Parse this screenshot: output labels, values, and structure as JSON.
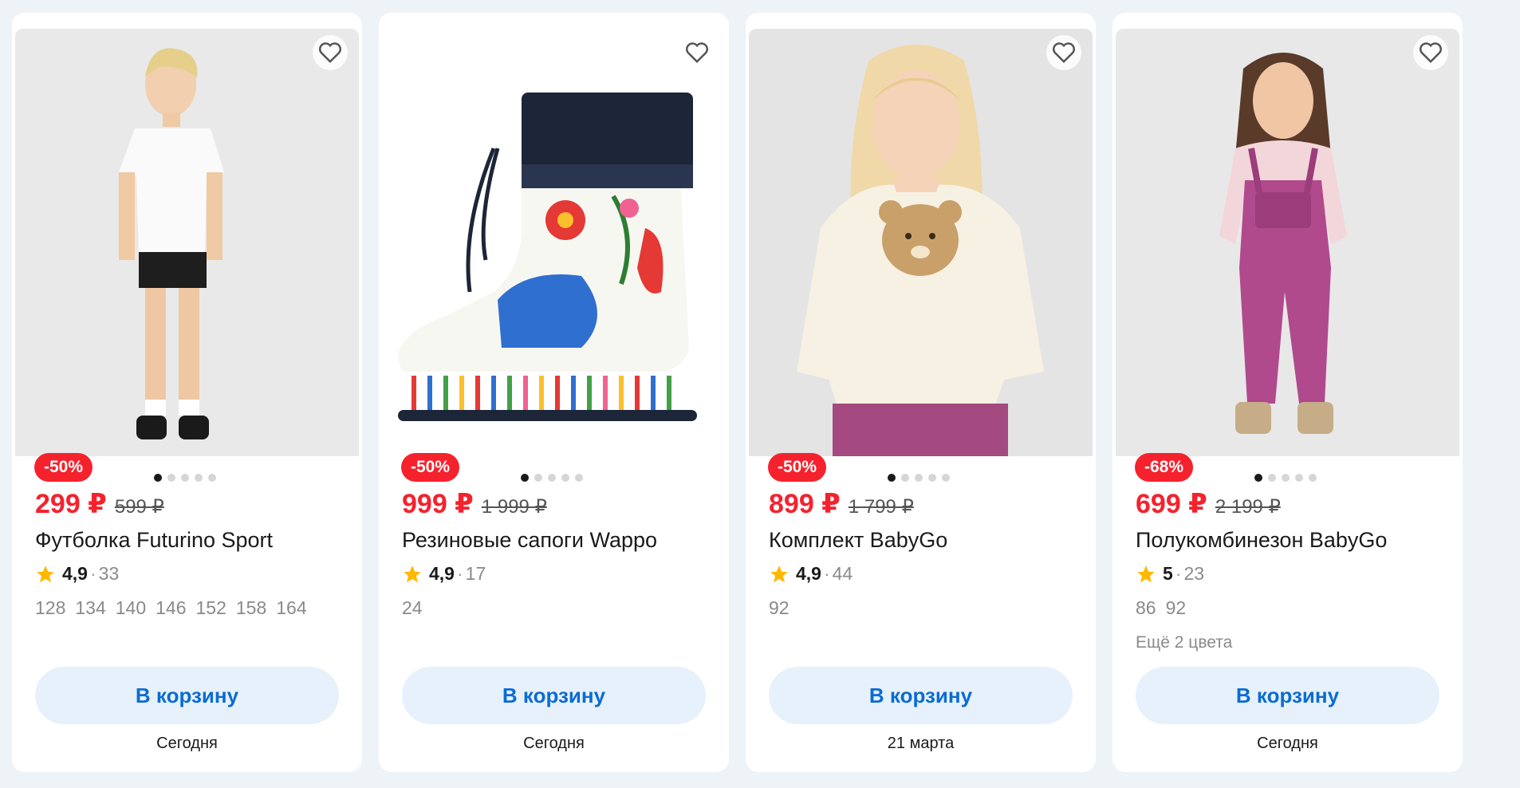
{
  "products": [
    {
      "discount": "-50%",
      "price": "299 ₽",
      "old_price": "599 ₽",
      "title": "Футболка Futurino Sport",
      "rating": "4,9",
      "reviews": "33",
      "sizes": [
        "128",
        "134",
        "140",
        "146",
        "152",
        "158",
        "164"
      ],
      "more_colors": "",
      "button": "В корзину",
      "delivery": "Сегодня",
      "photo": "boy-tshirt-shorts"
    },
    {
      "discount": "-50%",
      "price": "999 ₽",
      "old_price": "1 999 ₽",
      "title": "Резиновые сапоги Wappo",
      "rating": "4,9",
      "reviews": "17",
      "sizes": [
        "24"
      ],
      "more_colors": "",
      "button": "В корзину",
      "delivery": "Сегодня",
      "photo": "rubber-boot"
    },
    {
      "discount": "-50%",
      "price": "899 ₽",
      "old_price": "1 799 ₽",
      "title": "Комплект BabyGo",
      "rating": "4,9",
      "reviews": "44",
      "sizes": [
        "92"
      ],
      "more_colors": "",
      "button": "В корзину",
      "delivery": "21 марта",
      "photo": "girl-bear-sweatshirt"
    },
    {
      "discount": "-68%",
      "price": "699 ₽",
      "old_price": "2 199 ₽",
      "title": "Полукомбинезон BabyGo",
      "rating": "5",
      "reviews": "23",
      "sizes": [
        "86",
        "92"
      ],
      "more_colors": "Ещё 2 цвета",
      "button": "В корзину",
      "delivery": "Сегодня",
      "photo": "girl-overalls"
    }
  ],
  "colors": {
    "price": "#f5222d",
    "button_text": "#0a6cd3",
    "button_bg": "#e7f1fb",
    "star": "#ffb800"
  }
}
